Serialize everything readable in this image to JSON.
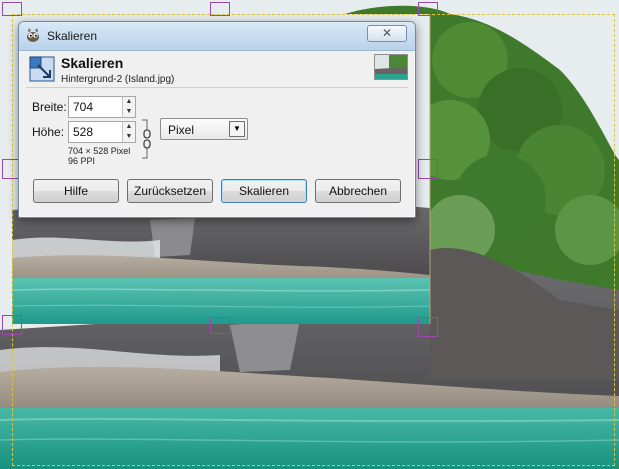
{
  "dialog": {
    "window_title": "Skalieren",
    "close_glyph": "✕",
    "header_title": "Skalieren",
    "header_subtitle": "Hintergrund-2 (Island.jpg)",
    "width_label": "Breite:",
    "width_value": "704",
    "height_label": "Höhe:",
    "height_value": "528",
    "unit_value": "Pixel",
    "size_info": "704 × 528 Pixel",
    "resolution_info": "96 PPI",
    "buttons": {
      "help": "Hilfe",
      "reset": "Zurücksetzen",
      "scale": "Skalieren",
      "cancel": "Abbrechen"
    }
  },
  "icons": {
    "title_icon": "gimp-wilber-icon",
    "header_icon": "scale-layer-icon",
    "chain_icon": "chain-link-icon",
    "dropdown_icon": "triangle-down-icon"
  },
  "colors": {
    "titlebar_top": "#d9e9f8",
    "titlebar_bottom": "#b9d2ea",
    "dialog_bg": "#f0f0f0",
    "handle": "#9a4aa8",
    "layer_boundary": "#d8c53a",
    "water": "#2aa89a",
    "foliage": "#3f7a2c"
  }
}
